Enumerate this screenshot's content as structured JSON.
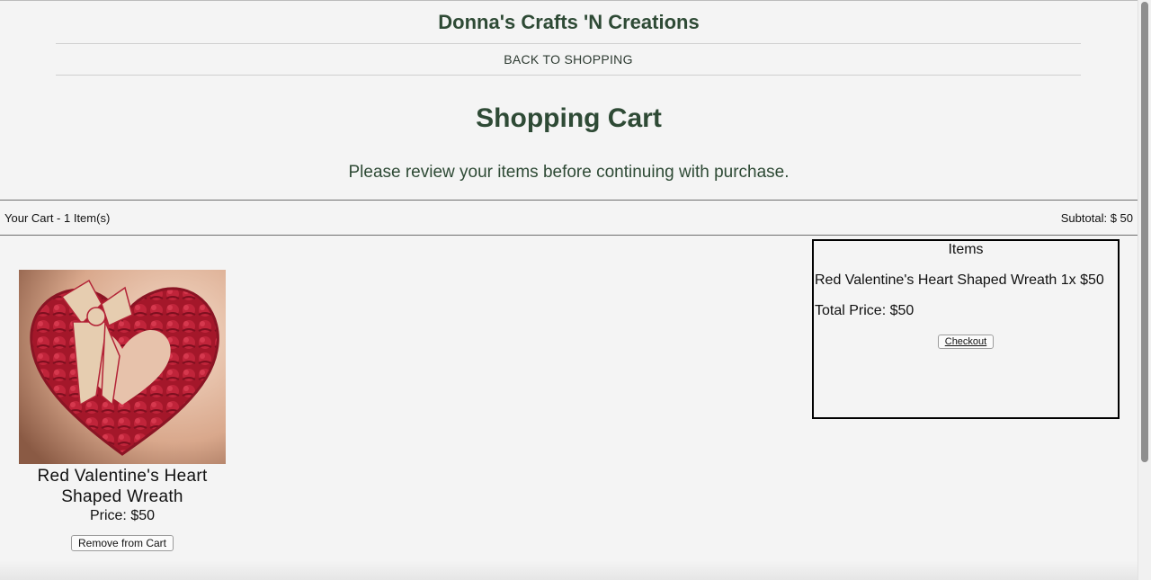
{
  "header": {
    "site_title": "Donna's Crafts 'N Creations",
    "nav_link": "BACK TO SHOPPING"
  },
  "page": {
    "title": "Shopping Cart",
    "subtitle": "Please review your items before continuing with purchase."
  },
  "cart_bar": {
    "count_label": "Your Cart - 1 Item(s)",
    "subtotal_label": "Subtotal: $ 50"
  },
  "products": [
    {
      "name": "Red Valentine's Heart Shaped Wreath",
      "price_label": "Price: $50",
      "remove_label": "Remove from Cart",
      "image_icon": "heart-wreath-image"
    }
  ],
  "summary": {
    "heading": "Items",
    "line_item": "Red Valentine's Heart Shaped Wreath 1x $50",
    "total": "Total Price: $50",
    "checkout_label": "Checkout"
  },
  "colors": {
    "brand_green": "#2e4a35",
    "background": "#f4f4f4",
    "wreath_red": "#b01c2e"
  }
}
